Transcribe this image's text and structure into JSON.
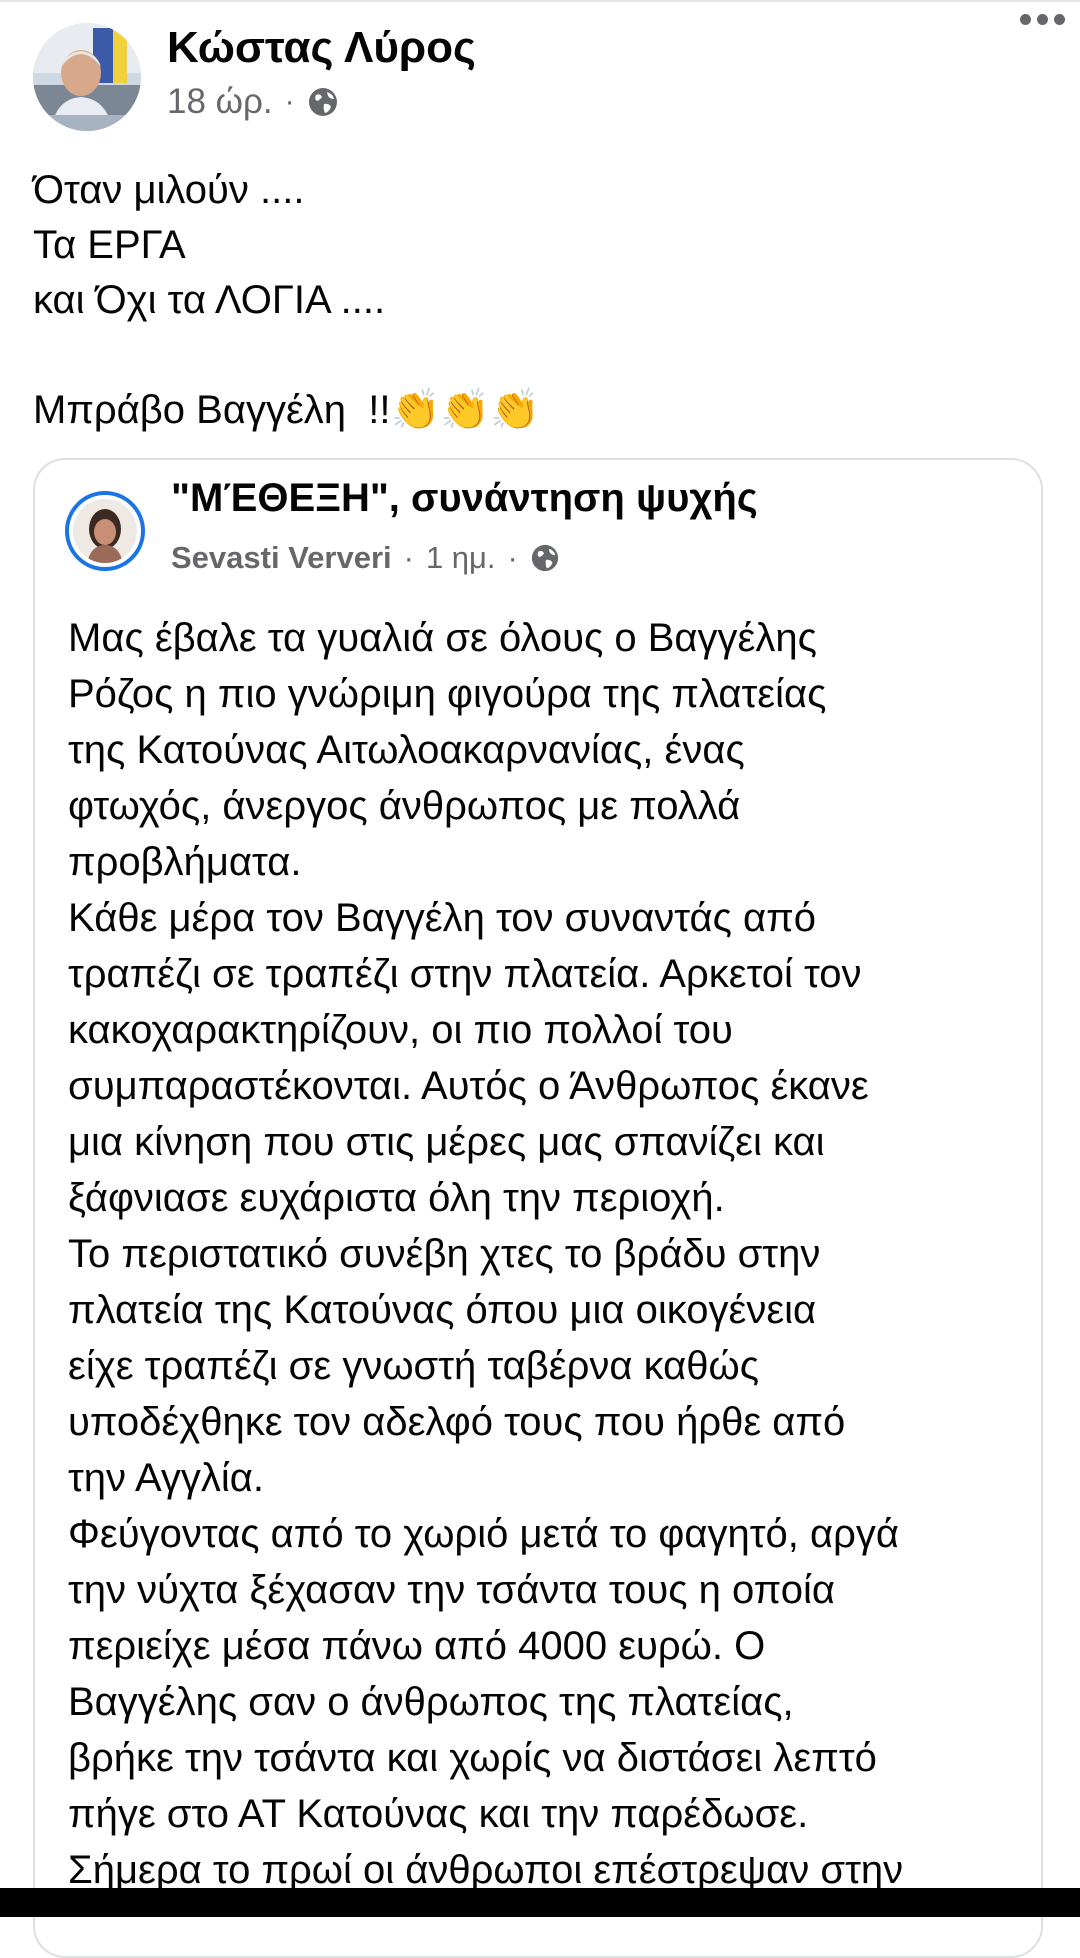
{
  "post": {
    "author": "Κώστας Λύρος",
    "time": "18 ώρ.",
    "separator": "·",
    "privacy_icon": "globe-icon",
    "text_lines": [
      "Όταν μιλούν ....",
      "Τα ΕΡΓΑ",
      "και Όχι τα ΛΟΓΙΑ ....",
      "",
      "Μπράβο Βαγγέλη  !!"
    ],
    "emoji": [
      "👏",
      "👏",
      "👏"
    ]
  },
  "shared": {
    "group": "\"ΜΈΘΕΞΗ\", συνάντηση ψυχής",
    "poster": "Sevasti Ververi",
    "time": "1 ημ.",
    "separator": "·",
    "privacy_icon": "globe-icon",
    "lines": [
      "Μας έβαλε τα γυαλιά σε όλους ο Βαγγέλης",
      "Ρόζος η πιο γνώριμη φιγούρα της πλατείας",
      "της Κατούνας Αιτωλοακαρνανίας, ένας",
      "φτωχός, άνεργος άνθρωπος με πολλά",
      "προβλήματα.",
      "Κάθε μέρα τον Βαγγέλη τον συναντάς από",
      "τραπέζι σε τραπέζι στην πλατεία. Αρκετοί τον",
      "κακοχαρακτηρίζουν, οι πιο πολλοί του",
      "συμπαραστέκονται. Αυτός ο Άνθρωπος έκανε",
      "μια κίνηση που στις μέρες μας σπανίζει και",
      "ξάφνιασε ευχάριστα όλη την περιοχή.",
      "Το περιστατικό συνέβη χτες το βράδυ στην",
      "πλατεία της Κατούνας όπου μια οικογένεια",
      "είχε τραπέζι σε γνωστή ταβέρνα καθώς",
      "υποδέχθηκε τον αδελφό τους που ήρθε από",
      "την Αγγλία.",
      "Φεύγοντας από το χωριό μετά το φαγητό, αργά",
      "την νύχτα ξέχασαν την τσάντα τους η οποία",
      "περιείχε μέσα πάνω από 4000 ευρώ. Ο",
      "Βαγγέλης σαν ο άνθρωπος της πλατείας,",
      "βρήκε την τσάντα και χωρίς να διστάσει λεπτό",
      "πήγε στο ΑΤ Κατούνας και την παρέδωσε.",
      "Σήμερα το πρωί οι άνθρωποι επέστρεψαν στην"
    ]
  }
}
